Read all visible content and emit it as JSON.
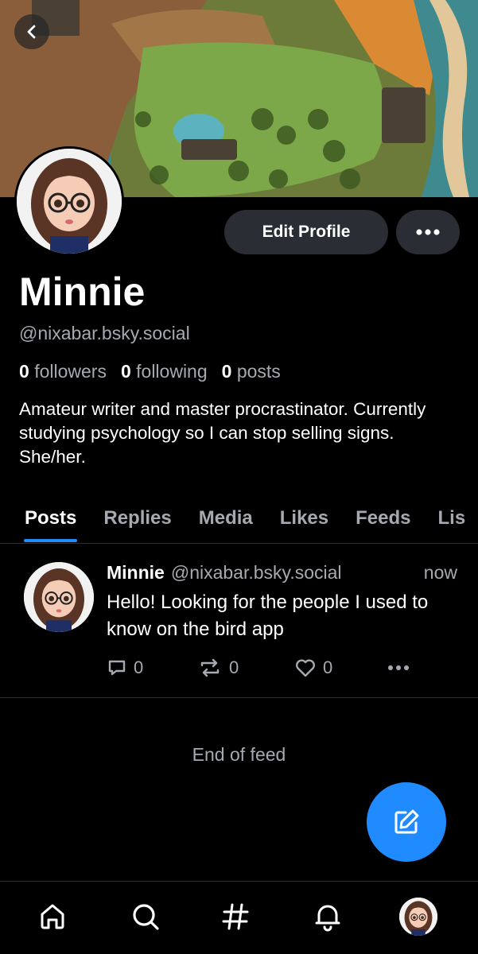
{
  "profile": {
    "name": "Minnie",
    "handle": "@nixabar.bsky.social",
    "followers_count": "0",
    "followers_label": "followers",
    "following_count": "0",
    "following_label": "following",
    "posts_count": "0",
    "posts_label": "posts",
    "bio": "Amateur writer and master procrastinator. Currently studying psychology so I can stop selling signs. She/her.",
    "edit_label": "Edit Profile"
  },
  "tabs": [
    {
      "label": "Posts",
      "active": true
    },
    {
      "label": "Replies"
    },
    {
      "label": "Media"
    },
    {
      "label": "Likes"
    },
    {
      "label": "Feeds"
    },
    {
      "label": "Lis"
    }
  ],
  "post": {
    "author": "Minnie",
    "handle": "@nixabar.bsky.social",
    "time": "now",
    "text": "Hello! Looking for the people I used to know on the bird app",
    "reply_count": "0",
    "repost_count": "0",
    "like_count": "0"
  },
  "feed_end": "End of feed",
  "icons": {
    "back": "back-chevron-icon",
    "more": "ellipsis-icon",
    "reply": "reply-bubble-icon",
    "repost": "repost-icon",
    "like": "heart-icon",
    "compose": "compose-icon",
    "home": "home-icon",
    "search": "search-icon",
    "feeds": "hashtag-icon",
    "notifications": "bell-icon"
  },
  "colors": {
    "accent": "#208bfe",
    "background": "#000000",
    "button_bg": "#2a2d33",
    "muted_text": "#a6a9b1"
  }
}
